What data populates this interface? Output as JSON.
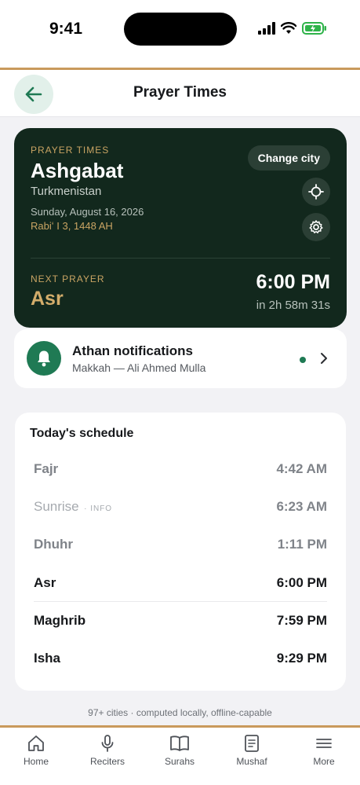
{
  "status_bar": {
    "time": "9:41"
  },
  "header": {
    "title": "Prayer Times"
  },
  "hero": {
    "kicker": "PRAYER TIMES",
    "city": "Ashgabat",
    "country": "Turkmenistan",
    "gregorian_date": "Sunday, August 16, 2026",
    "hijri_date": "Rabiʻ I 3, 1448 AH",
    "change_city_label": "Change city",
    "next_kicker": "NEXT PRAYER",
    "next_prayer": "Asr",
    "next_time": "6:00 PM",
    "countdown": "in 2h 58m 31s"
  },
  "athan": {
    "title": "Athan notifications",
    "subtitle": "Makkah — Ali Ahmed Mulla"
  },
  "schedule": {
    "title": "Today's schedule",
    "rows": [
      {
        "name": "Fajr",
        "time": "4:42 AM",
        "tag": ""
      },
      {
        "name": "Sunrise",
        "time": "6:23 AM",
        "tag": "· INFO"
      },
      {
        "name": "Dhuhr",
        "time": "1:11 PM",
        "tag": ""
      },
      {
        "name": "Asr",
        "time": "6:00 PM",
        "tag": ""
      },
      {
        "name": "Maghrib",
        "time": "7:59 PM",
        "tag": ""
      },
      {
        "name": "Isha",
        "time": "9:29 PM",
        "tag": ""
      }
    ]
  },
  "footer_note": "97+ cities · computed locally, offline-capable",
  "tabs": [
    {
      "label": "Home",
      "icon": "home-icon"
    },
    {
      "label": "Reciters",
      "icon": "microphone-icon"
    },
    {
      "label": "Surahs",
      "icon": "book-icon"
    },
    {
      "label": "Mushaf",
      "icon": "document-icon"
    },
    {
      "label": "More",
      "icon": "menu-icon"
    }
  ],
  "colors": {
    "accent_green": "#1f7a54",
    "hero_background": "#12281d",
    "gold": "#c9a463"
  }
}
